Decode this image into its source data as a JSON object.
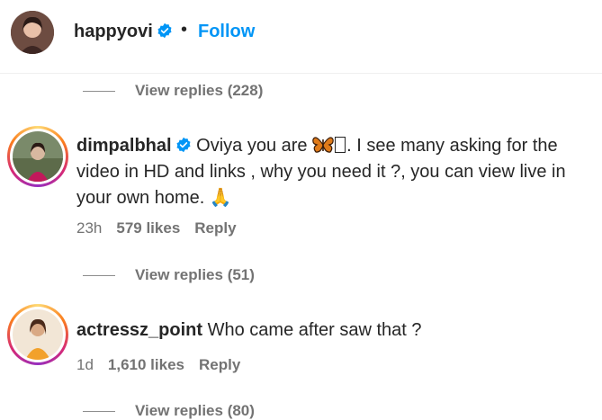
{
  "header": {
    "username": "happyovi",
    "separator": "•",
    "follow_label": "Follow"
  },
  "top_replies": {
    "label": "View replies (228)"
  },
  "comments": [
    {
      "username": "dimpalbhal",
      "verified": true,
      "text_start": "Oviya you are ",
      "text_rest": ". I see many asking for the video in HD and links , why you need it ?, you can view live in your own home. 🙏",
      "time": "23h",
      "likes": "579 likes",
      "reply_label": "Reply",
      "replies_label": "View replies (51)"
    },
    {
      "username": "actressz_point",
      "verified": false,
      "text": "Who came after saw that ?",
      "time": "1d",
      "likes": "1,610 likes",
      "reply_label": "Reply",
      "replies_label": "View replies (80)"
    }
  ],
  "colors": {
    "link_blue": "#0095f6",
    "verified_blue": "#0095f6",
    "muted": "#737373"
  },
  "icons": [
    "verified-badge-icon",
    "butterfly-emoji-icon",
    "praying-hands-emoji-icon"
  ]
}
